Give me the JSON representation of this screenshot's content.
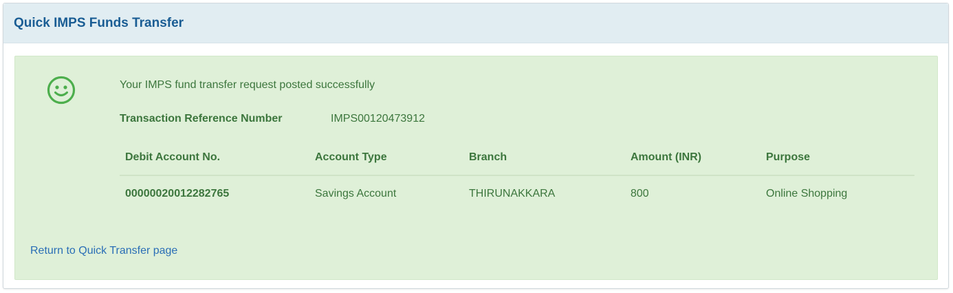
{
  "panel": {
    "title": "Quick IMPS Funds Transfer"
  },
  "alert": {
    "icon": "smiley-face-icon",
    "message": "Your IMPS fund transfer request posted successfully",
    "reference_label": "Transaction Reference Number",
    "reference_value": "IMPS00120473912",
    "success_color": "#3c763d",
    "background_color": "#dff0d8"
  },
  "table": {
    "headers": [
      "Debit Account No.",
      "Account Type",
      "Branch",
      "Amount (INR)",
      "Purpose"
    ],
    "rows": [
      [
        "00000020012282765",
        "Savings Account",
        "THIRUNAKKARA",
        "800",
        "Online Shopping"
      ]
    ]
  },
  "return_link": {
    "label": "Return to Quick Transfer page",
    "color": "#2a6eb6"
  }
}
